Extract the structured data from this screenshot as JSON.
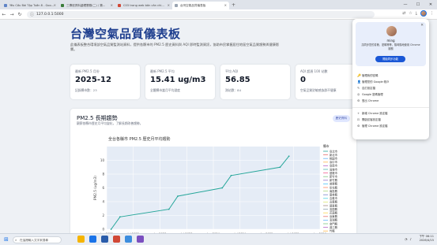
{
  "browser": {
    "tabs": [
      {
        "title": "Yêu Cầu Bài Tập Tuần 8 - Goo..."
      },
      {
        "title": "三專班資料處理實務(二) / 第..."
      },
      {
        "title": "C03 trang web bản căn chi..."
      },
      {
        "title": "台灣空氣品質儀表板"
      }
    ],
    "new_tab": "+",
    "url": "127.0.0.1:5000",
    "controls": {
      "minimize": "—",
      "maximize": "☐",
      "close": "✕"
    }
  },
  "page": {
    "title": "台灣空氣品質儀表板",
    "description": "此儀表板整合環境部空氣品質監測站資料，提供各縣市的 PM2.5 歷史資料與 AQI 即時監測資訊，協助市民掌握居住地區空氣品質趨勢與健康影響。",
    "stats": [
      {
        "label": "最新 PM2.5 月份",
        "value": "2025-12",
        "sub": "記錄縣市數：23"
      },
      {
        "label": "最新 PM2.5 平均",
        "value": "15.41 ug/m3",
        "sub": "全體縣市當月平均濃度"
      },
      {
        "label": "平均 AQI",
        "value": "56.85",
        "sub": "測站數：84"
      },
      {
        "label": "AQI 超過 100 站數",
        "value": "0",
        "sub": "空氣品質對敏感族群不健康"
      }
    ],
    "trend": {
      "title": "PM2.5 長期趨勢",
      "desc": "觀察各縣市歷史月平均變化，了解長期改善趨勢。",
      "pill": "歷史資料"
    }
  },
  "chart_data": {
    "type": "line",
    "title": "全台各縣市 PM2.5 歷史月平均趨勢",
    "xlabel": "",
    "ylabel": "PM2.5 (ug/m3)",
    "x_ticks": [
      "Jan 2022",
      "Jul 2022",
      "Jan 2023",
      "Jul 2023",
      "Jan 2024",
      "Jul 2024",
      "Jan 2025",
      "Jul 2025",
      "Jan 2026"
    ],
    "y_ticks": [
      "0",
      "2",
      "4",
      "6",
      "8",
      "10"
    ],
    "ylim": [
      0,
      12
    ],
    "legend_title": "縣市",
    "legend": [
      "臺北市",
      "新北市",
      "桃園市",
      "臺中市",
      "臺南市",
      "高雄市",
      "基隆市",
      "新竹市",
      "新竹縣",
      "苗栗縣",
      "彰化縣",
      "南投縣",
      "雲林縣",
      "嘉義市",
      "嘉義縣",
      "屏東縣",
      "宜蘭縣",
      "花蓮縣",
      "臺東縣",
      "澎湖縣",
      "金門縣",
      "連江縣",
      "竹縣"
    ],
    "legend_colors": [
      "#26a69a",
      "#e57373",
      "#64b5f6",
      "#ffb74d",
      "#ba68c8",
      "#4db6ac",
      "#f06292",
      "#81c784",
      "#9575cd",
      "#4fc3f7",
      "#ff8a65",
      "#aed581",
      "#7986cb",
      "#4dd0e1",
      "#dce775",
      "#a1887f",
      "#90a4ae",
      "#ffd54f",
      "#e57373",
      "#64b5f6",
      "#81c784",
      "#ba68c8",
      "#ffb74d"
    ],
    "series": [
      {
        "color": "#26a69a",
        "x": [
          "2022-02",
          "2022-04",
          "2023-03",
          "2023-05",
          "2024-03",
          "2024-05",
          "2025-04",
          "2025-06"
        ],
        "values": [
          0.0,
          1.8,
          2.9,
          4.8,
          6.0,
          7.8,
          9.0,
          10.6
        ]
      }
    ]
  },
  "popup": {
    "name": "ming",
    "message": "請同步您的書籤、密碼等等，隨時隨地使用 Chrome 服務",
    "sync_button": "開始同步功能",
    "items": [
      {
        "icon": "🔑",
        "label": "管理我的密碼"
      },
      {
        "icon": "👤",
        "label": "管理您的 Google 帳戶"
      },
      {
        "icon": "✎",
        "label": "自訂設定檔"
      },
      {
        "icon": "◎",
        "label": "Google 密碼管理"
      },
      {
        "icon": "⚙",
        "label": "登出 Chrome"
      },
      {
        "icon": "+",
        "label": "新增 Chrome 設定檔"
      },
      {
        "icon": "⊡",
        "label": "開啟訪客設定檔"
      },
      {
        "icon": "⚙",
        "label": "管理 Chrome 設定檔"
      }
    ]
  },
  "taskbar": {
    "search_placeholder": "在這裡輸入文字來搜尋",
    "time": "下午 06:11",
    "date": "2026/4/15",
    "app_colors": [
      "#f5b400",
      "#1a73e8",
      "#2a5caa",
      "#d14836",
      "#3c8dde",
      "#7b4fbf"
    ]
  }
}
